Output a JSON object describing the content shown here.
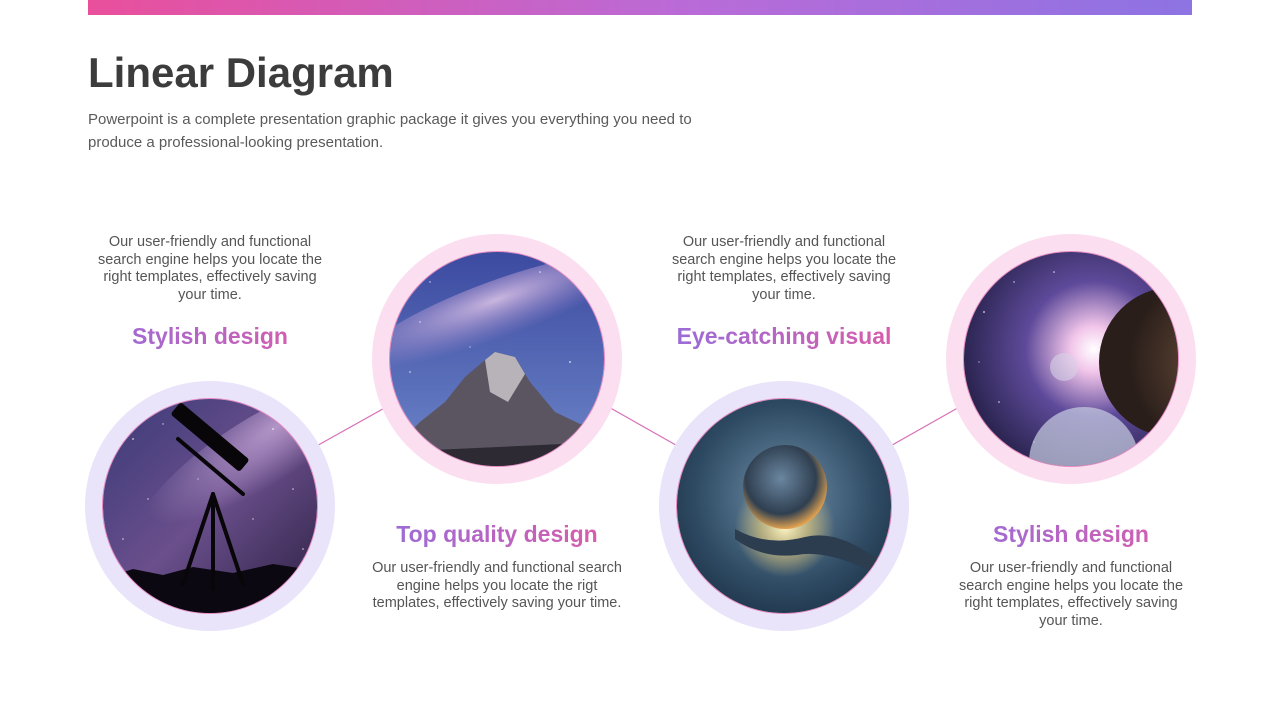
{
  "slide": {
    "title": "Linear Diagram",
    "subtitle": "Powerpoint is a complete presentation graphic package it gives you everything  you need to produce a professional-looking presentation."
  },
  "colors": {
    "accent_pink": "#e35aa3",
    "accent_purple": "#8f6fe0",
    "ring_lavender": "#e9e4fa",
    "ring_pink": "#fbdff0"
  },
  "steps": [
    {
      "heading": "Stylish design",
      "text": "Our user-friendly and functional search engine helps you locate the right templates, effectively saving your time.",
      "image": "telescope-night-sky"
    },
    {
      "heading": "Top quality design",
      "text": "Our user-friendly and functional search engine helps you locate the rigt templates, effectively saving your time.",
      "image": "mountain-milky-way"
    },
    {
      "heading": "Eye-catching visual",
      "text": "Our user-friendly and functional search engine helps you locate the right templates, effectively saving your time.",
      "image": "globe-in-hand"
    },
    {
      "heading": "Stylish design",
      "text": "Our user-friendly and functional search engine helps you locate the right templates, effectively saving your time.",
      "image": "planet-space"
    }
  ]
}
